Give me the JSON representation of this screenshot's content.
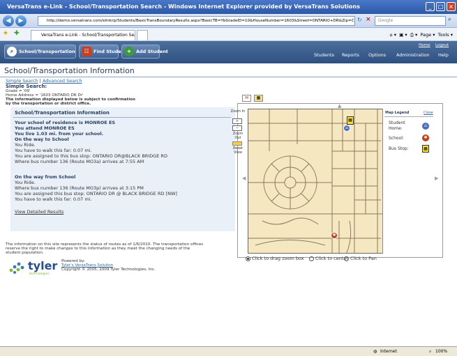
{
  "window": {
    "title": "VersaTrans e-Link - School/Transportation Search - Windows Internet Explorer provided by VersaTrans Solutions"
  },
  "browser": {
    "url": "http://demo.versatrans.com/elinkrp/Students/BasicTransBoundaryResults.aspx?BasicTB=YbGradeID=10&HouseNumber=1603&Street=ONTARIO+DR&Zip=Cr&GradeDesc=",
    "search_placeholder": "Google",
    "tab_label": "VersaTrans e-Link - School/Transportation Search",
    "cmd_page": "Page",
    "cmd_tools": "Tools"
  },
  "app": {
    "buttons": {
      "school": "School/Transportation",
      "find": "Find Students",
      "add": "Add Student"
    },
    "links": {
      "home": "Home",
      "logout": "Logout"
    },
    "menu": [
      "Students",
      "Reports",
      "Options",
      "Administration",
      "Help"
    ]
  },
  "page": {
    "title": "School/Transportation Information",
    "simple_search": "Simple Search",
    "advanced_search": "Advanced Search",
    "sep": "|",
    "search_heading": "Simple Search:",
    "grade": "Grade = '09'",
    "address": "Home Address = '1603 ONTARIO DR Dr'",
    "disclaimer_1": "The information displayed below is subject to confirmation",
    "disclaimer_2": "by the transportation or district office."
  },
  "info": {
    "heading": "School/Transportation Information",
    "residence": "Your school of residence is MONROE ES",
    "attend": "You attend MONROE ES",
    "distance": "You live 1.03 mi. from your school.",
    "way_to": "On the way to School",
    "to_ride": "You Ride.",
    "to_walk": "You have to walk this far: 0.07 mi.",
    "to_stop": "You are assigned to this bus stop: ONTARIO DR@BLACK BRIDGE RD",
    "to_bus": "Where bus number 136 (Route MO3a) arrives at 7:55 AM",
    "way_from": "On the way from School",
    "from_ride": "You Ride.",
    "from_bus": "Where bus number 136 (Route MO3p) arrives at 3:15 PM",
    "from_stop": "You are assigned this bus stop: ONTARIO DR @ BLACK BRIDGE RD [NW]",
    "from_walk": "You have to walk this far: 0.07 mi.",
    "view_details": "View Detailed Results"
  },
  "footer": {
    "notice_1": "The information on this site represents the status of routes as of 1/6/2010. The transportation offices",
    "notice_2": "reserve the right to make changes to this information as they meet the changing needs of the",
    "notice_3": "student population.",
    "logo_text": "tyler",
    "logo_sub": "technologies",
    "powered_by": "Powered by:",
    "solution": "Tyler's VersaTrans Solution",
    "copyright": "Copyright © 2005, 2009 Tyler Technologies, Inc."
  },
  "map": {
    "zoom_in": "Zoom In",
    "zoom_out": "Zoom Out",
    "reset_view": "Reset View",
    "legend_title": "Map Legend",
    "legend_close": "Close",
    "legend_student": "Student Home:",
    "legend_school": "School:",
    "legend_busstop": "Bus Stop:",
    "radio_zoom": "Click to drag zoom box",
    "radio_center": "Click to center",
    "radio_pan": "Click to Pan"
  },
  "status": {
    "zone": "Internet",
    "zoom": "100%"
  },
  "colors": {
    "header": "#2f5182",
    "panel": "#eaf0f8",
    "map": "#f5e7c0",
    "title": "#2a3f5f",
    "link": "#336699"
  }
}
